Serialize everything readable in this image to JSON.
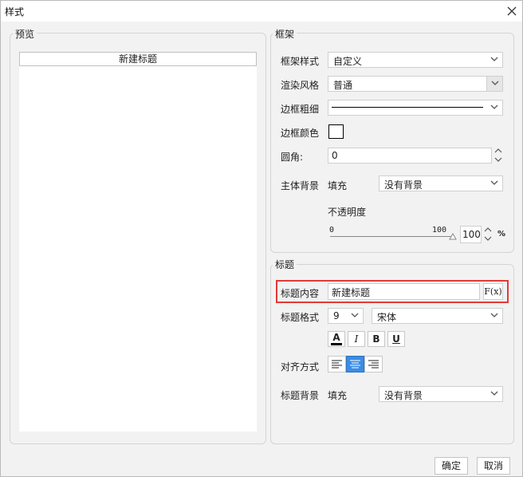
{
  "window": {
    "title": "样式",
    "close_icon": "close-icon"
  },
  "preview": {
    "legend": "预览",
    "title_text": "新建标题"
  },
  "frame": {
    "legend": "框架",
    "frame_style": {
      "label": "框架样式",
      "value": "自定义"
    },
    "render_style": {
      "label": "渲染风格",
      "value": "普通"
    },
    "border_width": {
      "label": "边框粗细"
    },
    "border_color": {
      "label": "边框颜色",
      "color": "#000000"
    },
    "corner": {
      "label": "圆角:",
      "value": "0"
    },
    "body_bg": {
      "label": "主体背景",
      "fill_label": "填充",
      "value": "没有背景"
    },
    "opacity": {
      "label": "不透明度",
      "min": "0",
      "max": "100",
      "value": "100",
      "unit": "%",
      "level": 1.0
    }
  },
  "title_section": {
    "legend": "标题",
    "content": {
      "label": "标题内容",
      "value": "新建标题",
      "formula_label": "F(x)"
    },
    "format": {
      "label": "标题格式",
      "size": "9",
      "font": "宋体"
    },
    "style_buttons": {
      "font_color": "A",
      "italic": "I",
      "bold": "B",
      "underline": "U"
    },
    "align": {
      "label": "对齐方式",
      "selected": "center"
    },
    "bg": {
      "label": "标题背景",
      "fill_label": "填充",
      "value": "没有背景"
    }
  },
  "footer": {
    "ok": "确定",
    "cancel": "取消"
  },
  "colors": {
    "highlight": "#e53935",
    "accent": "#3b8ce6"
  }
}
